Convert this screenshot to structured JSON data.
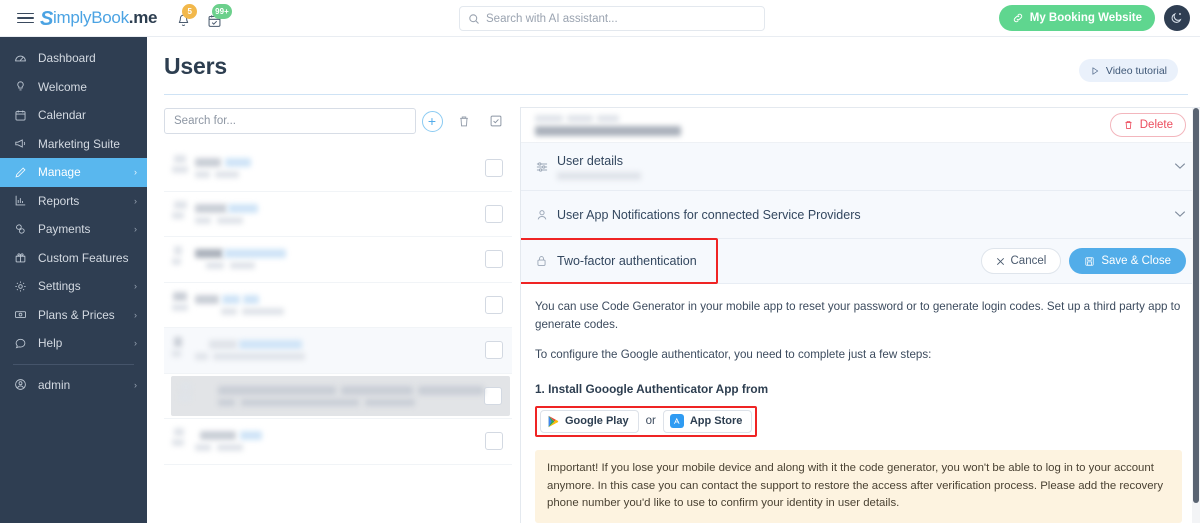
{
  "topbar": {
    "menu_icon": "hamburger-icon",
    "brand": {
      "s": "S",
      "mid": "implyBook",
      "suffix": ".me"
    },
    "bell": {
      "icon": "bell-icon",
      "badge": "5"
    },
    "calendar": {
      "icon": "calendar-check-icon",
      "badge": "99+"
    },
    "search": {
      "placeholder": "Search with AI assistant...",
      "value": "",
      "icon": "search-icon"
    },
    "booking_button": {
      "label": "My Booking Website",
      "icon": "link-icon",
      "color": "#5fd68f"
    },
    "night_mode": {
      "icon": "moon-icon"
    }
  },
  "sidebar": {
    "items": [
      {
        "label": "Dashboard",
        "icon": "dashboard-icon",
        "chevron": "",
        "active": false
      },
      {
        "label": "Welcome",
        "icon": "bulb-icon",
        "chevron": "",
        "active": false
      },
      {
        "label": "Calendar",
        "icon": "calendar-icon",
        "chevron": "",
        "active": false
      },
      {
        "label": "Marketing Suite",
        "icon": "megaphone-icon",
        "chevron": "",
        "active": false
      },
      {
        "label": "Manage",
        "icon": "pencil-icon",
        "chevron": "›",
        "active": true
      },
      {
        "label": "Reports",
        "icon": "chart-icon",
        "chevron": "›",
        "active": false
      },
      {
        "label": "Payments",
        "icon": "coins-icon",
        "chevron": "›",
        "active": false
      },
      {
        "label": "Custom Features",
        "icon": "gift-icon",
        "chevron": "",
        "active": false
      },
      {
        "label": "Settings",
        "icon": "gear-icon",
        "chevron": "›",
        "active": false
      },
      {
        "label": "Plans & Prices",
        "icon": "money-icon",
        "chevron": "›",
        "active": false
      },
      {
        "label": "Help",
        "icon": "chat-icon",
        "chevron": "›",
        "active": false
      }
    ],
    "account": {
      "label": "admin",
      "icon": "user-circle-icon",
      "chevron": "›"
    }
  },
  "page": {
    "title": "Users",
    "video_button": {
      "label": "Video tutorial",
      "icon": "play-icon"
    }
  },
  "user_list": {
    "search": {
      "placeholder": "Search for...",
      "value": ""
    },
    "actions": [
      {
        "name": "add-user-button",
        "icon": "plus-icon"
      },
      {
        "name": "delete-users-button",
        "icon": "trash-icon"
      },
      {
        "name": "select-all-button",
        "icon": "checkbox-icon"
      }
    ],
    "rows": [
      {
        "redacted": true,
        "selected": false
      },
      {
        "redacted": true,
        "selected": false
      },
      {
        "redacted": true,
        "selected": false
      },
      {
        "redacted": true,
        "selected": false
      },
      {
        "redacted": true,
        "selected": false,
        "highlighted": true
      },
      {
        "redacted": true,
        "selected": false,
        "tooltip": true
      },
      {
        "redacted": true,
        "selected": false
      }
    ]
  },
  "detail": {
    "header": {
      "name_redacted": true,
      "delete_button": {
        "label": "Delete",
        "icon": "trash-icon",
        "color": "#ec4d5e"
      }
    },
    "sections": [
      {
        "label": "User details",
        "icon": "sliders-icon",
        "subtitle_redacted": true,
        "expanded": false,
        "chevron": "⌄"
      },
      {
        "label": "User App Notifications for connected Service Providers",
        "icon": "user-icon",
        "expanded": false,
        "chevron": "⌄"
      },
      {
        "label": "Two-factor authentication",
        "icon": "lock-icon",
        "expanded": true,
        "annotated": true
      }
    ],
    "tfa_actions": {
      "cancel": {
        "label": "Cancel",
        "icon": "close-icon"
      },
      "save": {
        "label": "Save & Close",
        "icon": "save-icon",
        "color": "#52ade9"
      }
    },
    "tfa_body": {
      "p1": "You can use Code Generator in your mobile app to reset your password or to generate login codes. Set up a third party app to generate codes.",
      "p2": "To configure the Google authenticator, you need to complete just a few steps:",
      "step1": "1. Install Gooogle Authenticator App from",
      "store_google": {
        "label": "Google Play",
        "icon": "google-play-icon"
      },
      "or": "or",
      "store_apple": {
        "label": "App Store",
        "icon": "app-store-icon"
      },
      "warning": "Important! If you lose your mobile device and along with it the code generator, you won't be able to log in to your account anymore. In this case you can contact the support to restore the access after verification process. Please add the recovery phone number you'd like to use to confirm your identity in user details."
    }
  },
  "annotations": {
    "tfa_box_color": "#ef2424",
    "store_box_color": "#ef2424"
  }
}
